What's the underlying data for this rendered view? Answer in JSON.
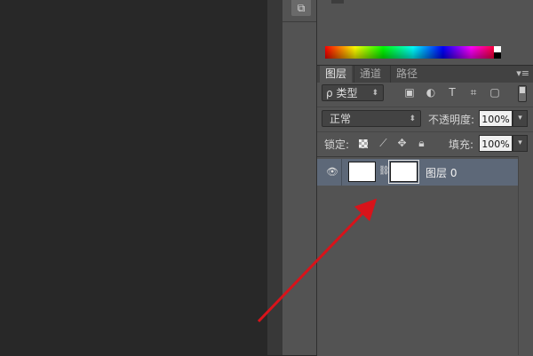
{
  "toolstrip": {
    "icon": "3d-cube-icon"
  },
  "tabs": [
    {
      "label": "图层",
      "active": true
    },
    {
      "label": "通道",
      "active": false
    },
    {
      "label": "路径",
      "active": false
    }
  ],
  "panel_menu": "▾≡",
  "filter": {
    "kind_label": "类型",
    "search_glyph": "ρ",
    "icons": [
      "image-filter-icon",
      "adjustment-filter-icon",
      "type-filter-icon",
      "shape-filter-icon",
      "smart-object-filter-icon"
    ]
  },
  "blend": {
    "mode": "正常",
    "opacity_label": "不透明度:",
    "opacity_value": "100%"
  },
  "lock": {
    "label": "锁定:",
    "fill_label": "填充:",
    "fill_value": "100%"
  },
  "layers": [
    {
      "name": "图层 0",
      "visible": true,
      "has_mask": true
    }
  ],
  "colors": {
    "selected_row": "#5d6878",
    "annotation_arrow": "#d8131a"
  }
}
